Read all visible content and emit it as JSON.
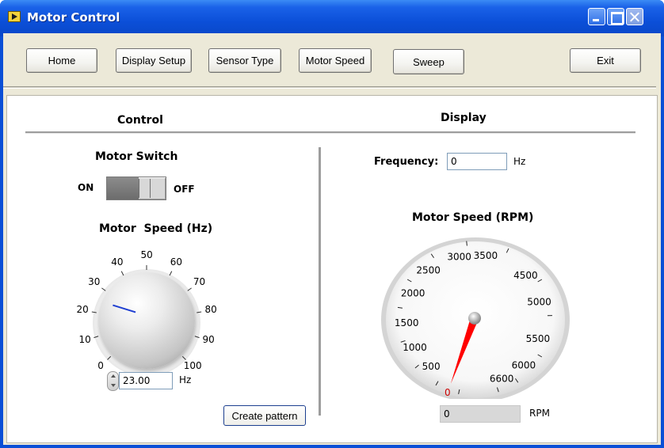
{
  "window": {
    "title": "Motor Control"
  },
  "toolbar": {
    "buttons": [
      {
        "label": "Home"
      },
      {
        "label": "Display Setup"
      },
      {
        "label": "Sensor Type"
      },
      {
        "label": "Motor Speed"
      },
      {
        "label": "Sweep"
      },
      {
        "label": "Exit"
      }
    ]
  },
  "control": {
    "header": "Control",
    "motor_switch": {
      "title": "Motor Switch",
      "on_label": "ON",
      "off_label": "OFF"
    },
    "motor_speed": {
      "title": "Motor  Speed (Hz)",
      "ticks": [
        "0",
        "10",
        "20",
        "30",
        "40",
        "50",
        "60",
        "70",
        "80",
        "90",
        "100"
      ],
      "value": "23.00",
      "value_num": 23,
      "unit": "Hz",
      "min": 0,
      "max": 100
    },
    "create_pattern_label": "Create pattern"
  },
  "display": {
    "header": "Display",
    "frequency": {
      "label": "Frequency:",
      "value": "0",
      "unit": "Hz"
    },
    "gauge": {
      "title": "Motor Speed (RPM)",
      "ticks": [
        "0",
        "500",
        "1000",
        "1500",
        "2000",
        "2500",
        "3000",
        "3500",
        "4500",
        "5000",
        "5500",
        "6000",
        "6600"
      ],
      "value_num": 0,
      "readout": "0",
      "unit": "RPM",
      "needle_color": "#ff0000"
    }
  }
}
